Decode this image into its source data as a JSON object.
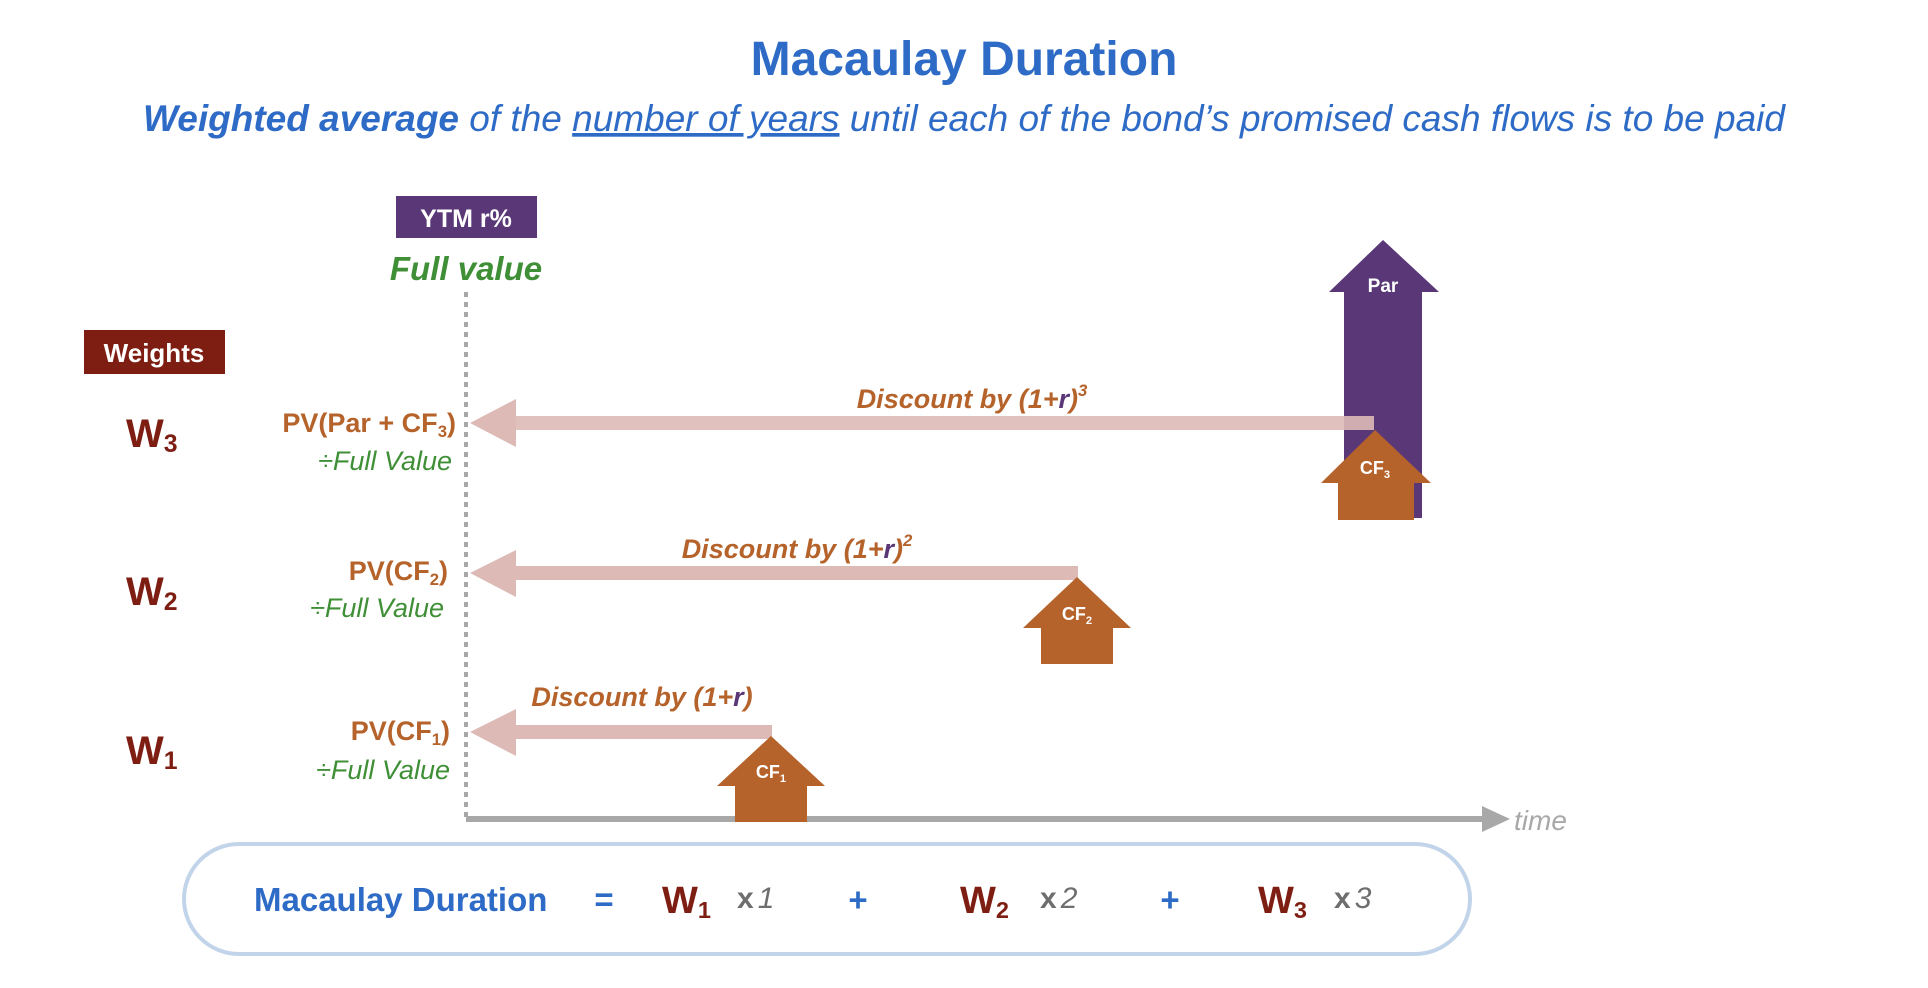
{
  "title": "Macaulay Duration",
  "subtitle": {
    "part1": "Weighted average",
    "part2": " of the ",
    "part3": "number of years",
    "part4": " until each of the bond’s promised cash flows is to be paid"
  },
  "ytm_label": "YTM r%",
  "full_value_label": "Full value",
  "weights_label": "Weights",
  "time_label": "time",
  "par_label": "Par",
  "rows": [
    {
      "weight_base": "W",
      "weight_sub": "3",
      "pv_prefix": "PV(Par + CF",
      "pv_sub": "3",
      "pv_suffix": ")",
      "divide_label": "÷Full Value",
      "discount_prefix": "Discount by (1+",
      "discount_r": "r",
      "discount_suffix": ")",
      "discount_exp": "3",
      "cf_base": "CF",
      "cf_sub": "3"
    },
    {
      "weight_base": "W",
      "weight_sub": "2",
      "pv_prefix": "PV(CF",
      "pv_sub": "2",
      "pv_suffix": ")",
      "divide_label": "÷Full Value",
      "discount_prefix": "Discount by (1+",
      "discount_r": "r",
      "discount_suffix": ")",
      "discount_exp": "2",
      "cf_base": "CF",
      "cf_sub": "2"
    },
    {
      "weight_base": "W",
      "weight_sub": "1",
      "pv_prefix": "PV(CF",
      "pv_sub": "1",
      "pv_suffix": ")",
      "divide_label": "÷Full Value",
      "discount_prefix": "Discount by (1+",
      "discount_r": "r",
      "discount_suffix": ")",
      "discount_exp": "",
      "cf_base": "CF",
      "cf_sub": "1"
    }
  ],
  "formula": {
    "label": "Macaulay Duration",
    "equals": "=",
    "plus": "+",
    "times": "x",
    "terms": [
      {
        "w_base": "W",
        "w_sub": "1",
        "t": "1"
      },
      {
        "w_base": "W",
        "w_sub": "2",
        "t": "2"
      },
      {
        "w_base": "W",
        "w_sub": "3",
        "t": "3"
      }
    ]
  },
  "colors": {
    "blue": "#2E6BC6",
    "purple": "#5A3878",
    "green": "#3F8F36",
    "maroon": "#7E1E12",
    "orange": "#B5632B",
    "pink_arrow": "#DDBAB6",
    "axis_gray": "#A8A8A8",
    "formula_border": "#C2D4EA"
  }
}
